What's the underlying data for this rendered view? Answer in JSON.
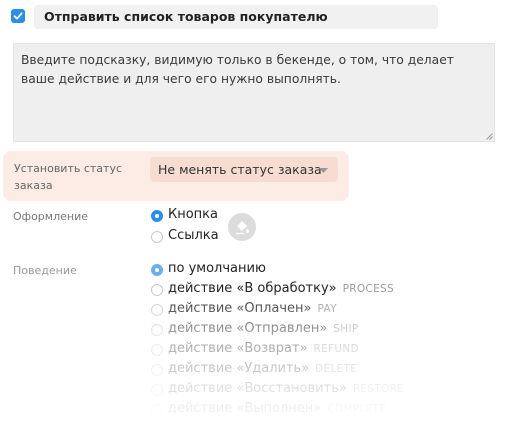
{
  "header": {
    "checkbox_checked": true,
    "title": "Отправить список товаров покупателю"
  },
  "hint": {
    "text": "Введите подсказку, видимую только в бекенде, о том, что делает ваше действие и для чего его нужно выполнять."
  },
  "status": {
    "label": "Установить статус заказа",
    "selected": "Не менять статус заказа"
  },
  "appearance": {
    "label": "Оформление",
    "options": [
      {
        "label": "Кнопка",
        "selected": true
      },
      {
        "label": "Ссылка",
        "selected": false
      }
    ]
  },
  "behavior": {
    "label": "Поведение",
    "options": [
      {
        "label": "по умолчанию",
        "code": "",
        "selected": true
      },
      {
        "label": "действие «В обработку»",
        "code": "PROCESS",
        "selected": false
      },
      {
        "label": "действие «Оплачен»",
        "code": "PAY",
        "selected": false
      },
      {
        "label": "действие «Отправлен»",
        "code": "SHIP",
        "selected": false
      },
      {
        "label": "действие «Возврат»",
        "code": "REFUND",
        "selected": false
      },
      {
        "label": "действие «Удалить»",
        "code": "DELETE",
        "selected": false
      },
      {
        "label": "действие «Восстановить»",
        "code": "RESTORE",
        "selected": false
      },
      {
        "label": "действие «Выполнен»",
        "code": "COMPLETE",
        "selected": false
      }
    ]
  },
  "colors": {
    "accent": "#2b8ee8",
    "highlight_bg": "#fdece6",
    "select_bg": "#f7dcd1"
  }
}
